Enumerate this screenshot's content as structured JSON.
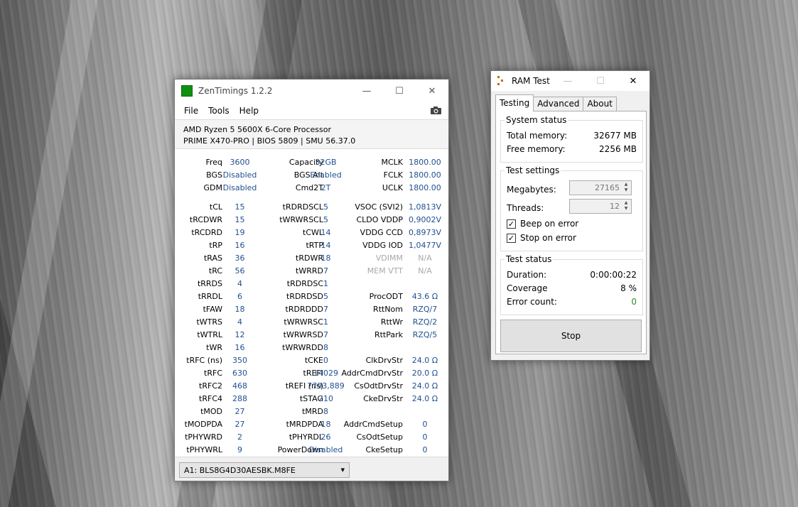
{
  "zentimings": {
    "title": "ZenTimings 1.2.2",
    "minimize": "—",
    "maximize": "☐",
    "close": "✕",
    "menu": [
      "File",
      "Tools",
      "Help"
    ],
    "cpu": "AMD Ryzen 5 5600X 6-Core Processor",
    "board": "PRIME X470-PRO | BIOS 5809 | SMU 56.37.0",
    "rows": [
      [
        [
          "Freq",
          "3600"
        ],
        [
          "Capacity",
          "32GB"
        ],
        [
          "MCLK",
          "1800.00"
        ]
      ],
      [
        [
          "BGS",
          "Disabled"
        ],
        [
          "BGS Alt",
          "Enabled"
        ],
        [
          "FCLK",
          "1800.00"
        ]
      ],
      [
        [
          "GDM",
          "Disabled"
        ],
        [
          "Cmd2T",
          "2T"
        ],
        [
          "UCLK",
          "1800.00"
        ]
      ],
      [
        [
          "tCL",
          "15"
        ],
        [
          "tRDRDSCL",
          "5"
        ],
        [
          "VSOC (SVI2)",
          "1,0813V"
        ]
      ],
      [
        [
          "tRCDWR",
          "15"
        ],
        [
          "tWRWRSCL",
          "5"
        ],
        [
          "CLDO VDDP",
          "0,9002V"
        ]
      ],
      [
        [
          "tRCDRD",
          "19"
        ],
        [
          "tCWL",
          "14"
        ],
        [
          "VDDG CCD",
          "0,8973V"
        ]
      ],
      [
        [
          "tRP",
          "16"
        ],
        [
          "tRTP",
          "14"
        ],
        [
          "VDDG IOD",
          "1,0477V"
        ]
      ],
      [
        [
          "tRAS",
          "36"
        ],
        [
          "tRDWR",
          "18"
        ],
        [
          "VDIMM",
          "N/A"
        ]
      ],
      [
        [
          "tRC",
          "56"
        ],
        [
          "tWRRD",
          "7"
        ],
        [
          "MEM VTT",
          "N/A"
        ]
      ],
      [
        [
          "tRRDS",
          "4"
        ],
        [
          "tRDRDSC",
          "1"
        ],
        [
          "",
          ""
        ]
      ],
      [
        [
          "tRRDL",
          "6"
        ],
        [
          "tRDRDSD",
          "5"
        ],
        [
          "ProcODT",
          "43.6 Ω"
        ]
      ],
      [
        [
          "tFAW",
          "18"
        ],
        [
          "tRDRDDD",
          "7"
        ],
        [
          "RttNom",
          "RZQ/7"
        ]
      ],
      [
        [
          "tWTRS",
          "4"
        ],
        [
          "tWRWRSC",
          "1"
        ],
        [
          "RttWr",
          "RZQ/2"
        ]
      ],
      [
        [
          "tWTRL",
          "12"
        ],
        [
          "tWRWRSD",
          "7"
        ],
        [
          "RttPark",
          "RZQ/5"
        ]
      ],
      [
        [
          "tWR",
          "16"
        ],
        [
          "tWRWRDD",
          "8"
        ],
        [
          "",
          ""
        ]
      ],
      [
        [
          "tRFC (ns)",
          "350"
        ],
        [
          "tCKE",
          "0"
        ],
        [
          "ClkDrvStr",
          "24.0 Ω"
        ]
      ],
      [
        [
          "tRFC",
          "630"
        ],
        [
          "tREFI",
          "14029"
        ],
        [
          "AddrCmdDrvStr",
          "20.0 Ω"
        ]
      ],
      [
        [
          "tRFC2",
          "468"
        ],
        [
          "tREFI (ns)",
          "7793,889"
        ],
        [
          "CsOdtDrvStr",
          "24.0 Ω"
        ]
      ],
      [
        [
          "tRFC4",
          "288"
        ],
        [
          "tSTAG",
          "210"
        ],
        [
          "CkeDrvStr",
          "24.0 Ω"
        ]
      ],
      [
        [
          "tMOD",
          "27"
        ],
        [
          "tMRD",
          "8"
        ],
        [
          "",
          ""
        ]
      ],
      [
        [
          "tMODPDA",
          "27"
        ],
        [
          "tMRDPDA",
          "18"
        ],
        [
          "AddrCmdSetup",
          "0"
        ]
      ],
      [
        [
          "tPHYWRD",
          "2"
        ],
        [
          "tPHYRDL",
          "26"
        ],
        [
          "CsOdtSetup",
          "0"
        ]
      ],
      [
        [
          "tPHYWRL",
          "9"
        ],
        [
          "PowerDown",
          "Disabled"
        ],
        [
          "CkeSetup",
          "0"
        ]
      ]
    ],
    "module": "A1: BLS8G4D30AESBK.M8FE"
  },
  "ramtest": {
    "title": "RAM Test",
    "minimize": "—",
    "maximize": "☐",
    "close": "✕",
    "tabs": [
      "Testing",
      "Advanced",
      "About"
    ],
    "system_status": "System status",
    "total_memory_label": "Total memory:",
    "total_memory": "32677 MB",
    "free_memory_label": "Free memory:",
    "free_memory": "2256 MB",
    "test_settings": "Test settings",
    "megabytes_label": "Megabytes:",
    "megabytes": "27165",
    "threads_label": "Threads:",
    "threads": "12",
    "beep_label": "Beep on error",
    "beep_checked": true,
    "stop_on_error_label": "Stop on error",
    "stop_checked": true,
    "test_status": "Test status",
    "duration_label": "Duration:",
    "duration": "0:00:00:22",
    "coverage_label": "Coverage",
    "coverage": "8 %",
    "errors_label": "Error count:",
    "errors": "0",
    "stop_button": "Stop",
    "error_color": "#2e8b2e"
  }
}
